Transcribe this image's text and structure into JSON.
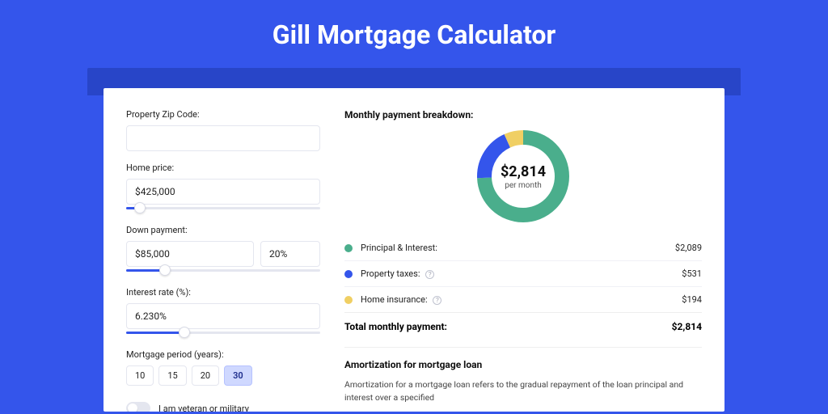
{
  "hero": {
    "title": "Gill Mortgage Calculator"
  },
  "form": {
    "zip": {
      "label": "Property Zip Code:",
      "value": ""
    },
    "price": {
      "label": "Home price:",
      "value": "$425,000",
      "slider_pct": 7
    },
    "down": {
      "label": "Down payment:",
      "amount": "$85,000",
      "percent": "20%",
      "slider_pct": 20
    },
    "rate": {
      "label": "Interest rate (%):",
      "value": "6.230%",
      "slider_pct": 30
    },
    "period": {
      "label": "Mortgage period (years):",
      "options": [
        "10",
        "15",
        "20",
        "30"
      ],
      "selected": "30"
    },
    "veteran_label": "I am veteran or military"
  },
  "breakdown": {
    "title": "Monthly payment breakdown:",
    "center_value": "$2,814",
    "center_sub": "per month",
    "items": [
      {
        "label": "Principal & Interest:",
        "value": "$2,089",
        "color": "#4aae8c",
        "info": false
      },
      {
        "label": "Property taxes:",
        "value": "$531",
        "color": "#3455eb",
        "info": true
      },
      {
        "label": "Home insurance:",
        "value": "$194",
        "color": "#f0cf63",
        "info": true
      }
    ],
    "total_label": "Total monthly payment:",
    "total_value": "$2,814"
  },
  "amort": {
    "heading": "Amortization for mortgage loan",
    "body": "Amortization for a mortgage loan refers to the gradual repayment of the loan principal and interest over a specified"
  },
  "chart_data": {
    "type": "pie",
    "title": "Monthly payment breakdown",
    "series": [
      {
        "name": "Principal & Interest",
        "value": 2089,
        "color": "#4aae8c"
      },
      {
        "name": "Property taxes",
        "value": 531,
        "color": "#3455eb"
      },
      {
        "name": "Home insurance",
        "value": 194,
        "color": "#f0cf63"
      }
    ],
    "total": 2814,
    "center_label": "$2,814 per month"
  }
}
